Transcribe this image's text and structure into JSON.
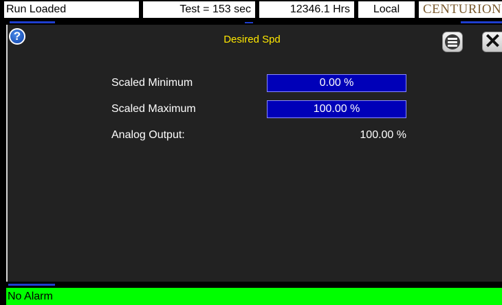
{
  "status_bar": {
    "run_state": "Run Loaded",
    "test_timer": "Test = 153 sec",
    "hours": "12346.1 Hrs",
    "control_mode": "Local",
    "brand": "CENTURION"
  },
  "dialog": {
    "title": "Desired Spd",
    "help_icon": "help-icon",
    "menu_icon": "menu-icon",
    "close_icon": "close-icon",
    "fields": [
      {
        "label": "Scaled Minimum",
        "value": "0.00 %"
      },
      {
        "label": "Scaled Maximum",
        "value": "100.00 %"
      },
      {
        "label": "Analog Output:",
        "value": "100.00 %"
      }
    ]
  },
  "alarm_bar": {
    "text": "No Alarm",
    "color": "#00ff00"
  },
  "colors": {
    "title": "#ffe800",
    "input_background": "#0000b8",
    "panel_background": "#222222",
    "brand": "#7a5a2e"
  }
}
